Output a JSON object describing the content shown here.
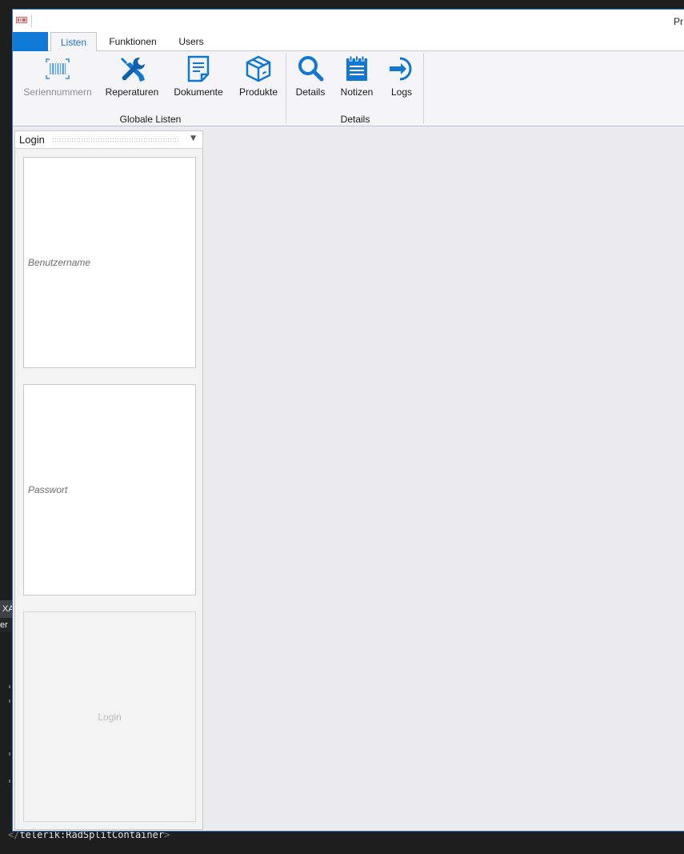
{
  "ide": {
    "tab_text": "XA",
    "tab2_text": "er",
    "code_line_open": "</",
    "code_line_tag": "telerik:RadSplitContainer",
    "code_line_close": ">"
  },
  "window": {
    "title": "Pr"
  },
  "tabs": [
    {
      "label": "Listen",
      "active": true
    },
    {
      "label": "Funktionen",
      "active": false
    },
    {
      "label": "Users",
      "active": false
    }
  ],
  "ribbon": {
    "groups": [
      {
        "label": "Globale Listen",
        "buttons": [
          {
            "label": "Seriennummern",
            "icon": "barcode-icon",
            "enabled": false
          },
          {
            "label": "Reperaturen",
            "icon": "tools-icon",
            "enabled": true
          },
          {
            "label": "Dokumente",
            "icon": "document-icon",
            "enabled": true
          },
          {
            "label": "Produkte",
            "icon": "box-icon",
            "enabled": true
          }
        ]
      },
      {
        "label": "Details",
        "buttons": [
          {
            "label": "Details",
            "icon": "search-icon",
            "enabled": true
          },
          {
            "label": "Notizen",
            "icon": "notepad-icon",
            "enabled": true
          },
          {
            "label": "Logs",
            "icon": "login-arrow-icon",
            "enabled": true
          }
        ]
      }
    ]
  },
  "login_panel": {
    "title": "Login",
    "username_placeholder": "Benutzername",
    "password_placeholder": "Passwort",
    "login_button": "Login"
  },
  "colors": {
    "accent": "#0e79d6",
    "icon_blue": "#1178d2",
    "disabled_icon": "#5fa8e6",
    "content_bg": "#ebebf0"
  }
}
